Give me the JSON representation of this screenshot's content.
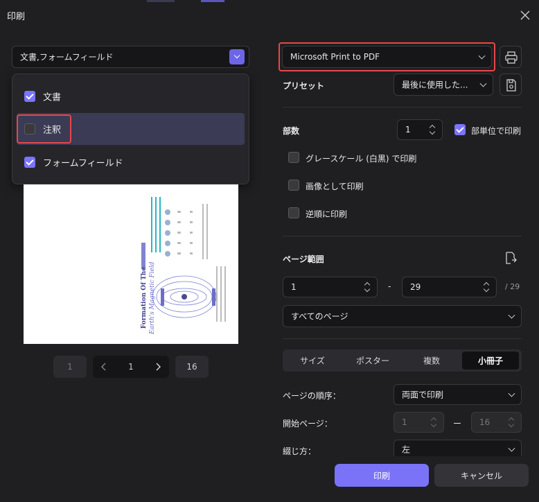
{
  "window": {
    "title": "印刷"
  },
  "content_filter": {
    "value": "文書,フォームフィールド",
    "options": [
      {
        "label": "文書",
        "checked": true
      },
      {
        "label": "注釈",
        "checked": false
      },
      {
        "label": "フォームフィールド",
        "checked": true
      }
    ]
  },
  "preview": {
    "title_line1": "Formation Of The",
    "title_line2": "Earth's Magnetic Field"
  },
  "pager": {
    "prev_page": "1",
    "current": "1",
    "last": "16"
  },
  "printer": {
    "selected": "Microsoft Print to PDF"
  },
  "preset": {
    "label": "プリセット",
    "value": "最後に使用した..."
  },
  "copies": {
    "label": "部数",
    "value": "1",
    "collate_label": "部単位で印刷",
    "collate_checked": true
  },
  "options": {
    "grayscale": "グレースケール (白黒) で印刷",
    "as_image": "画像として印刷",
    "reverse": "逆順に印刷"
  },
  "page_range": {
    "label": "ページ範囲",
    "from": "1",
    "to": "29",
    "separator": "-",
    "total": "/ 29",
    "subset": "すべてのページ"
  },
  "layout_tabs": [
    "サイズ",
    "ポスター",
    "複数",
    "小冊子"
  ],
  "booklet": {
    "order_label": "ページの順序：",
    "order_value": "両面で印刷",
    "start_label": "開始ページ：",
    "start_from": "1",
    "start_dash": "ー",
    "start_to": "16",
    "binding_label": "綴じ方：",
    "binding_value": "左"
  },
  "actions": {
    "print": "印刷",
    "cancel": "キャンセル"
  },
  "colors": {
    "accent": "#7a73f8",
    "highlight": "#e8474a",
    "background": "#1f1f22"
  }
}
